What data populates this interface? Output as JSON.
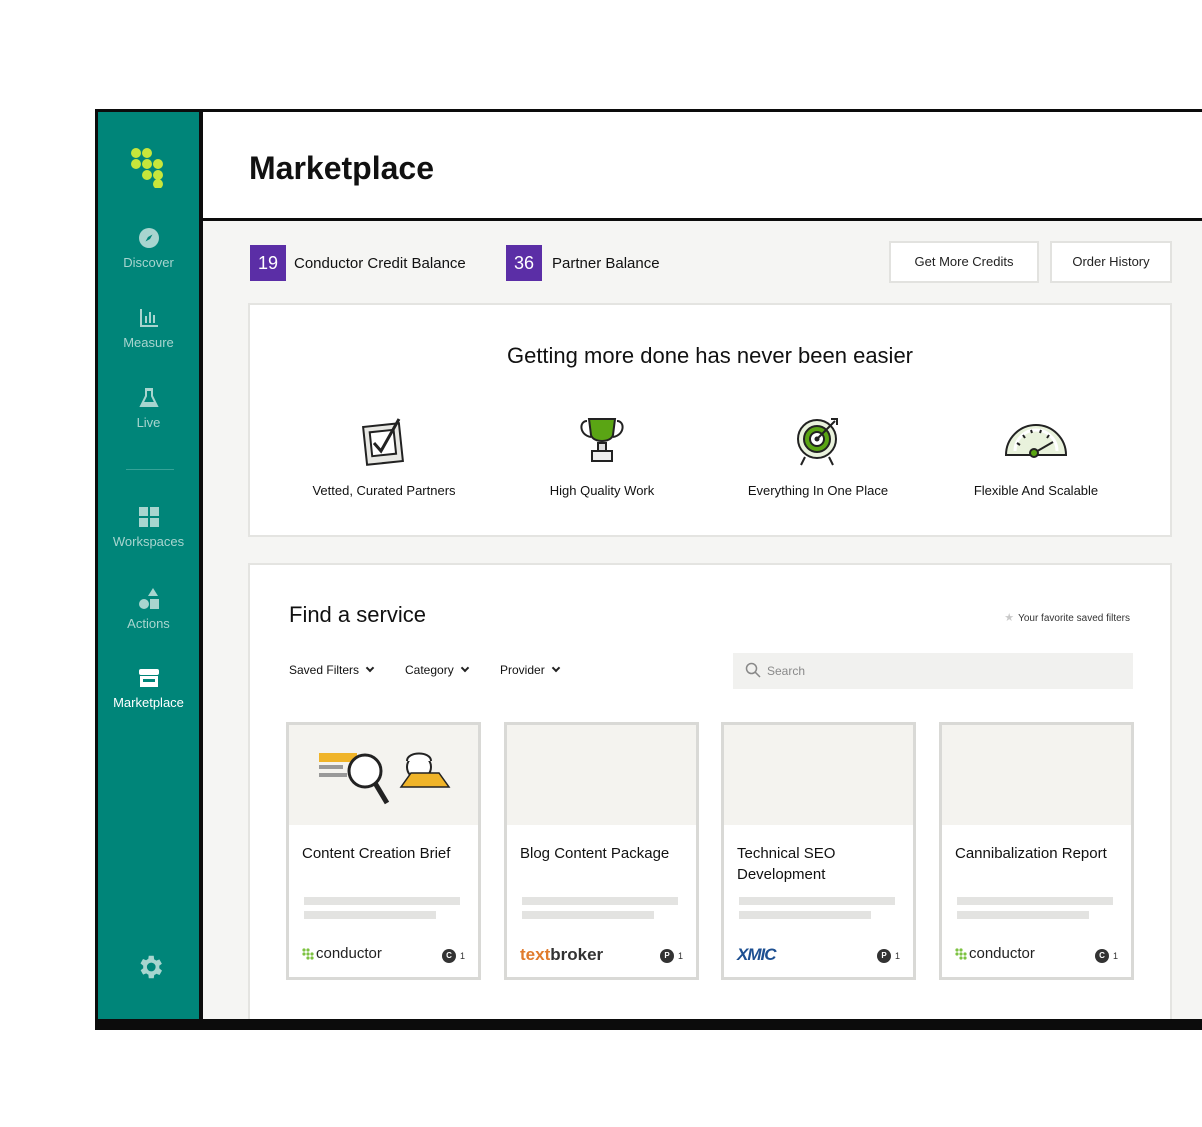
{
  "sidebar": {
    "items": [
      {
        "label": "Discover",
        "icon": "compass-icon"
      },
      {
        "label": "Measure",
        "icon": "bar-chart-icon"
      },
      {
        "label": "Live",
        "icon": "flask-icon"
      },
      {
        "label": "Workspaces",
        "icon": "grid-icon"
      },
      {
        "label": "Actions",
        "icon": "shapes-icon"
      },
      {
        "label": "Marketplace",
        "icon": "storefront-icon",
        "active": true
      }
    ],
    "settings_icon": "gear-icon",
    "accent": "#008579"
  },
  "header": {
    "title": "Marketplace"
  },
  "balances": {
    "credit_value": "19",
    "credit_label": "Conductor Credit Balance",
    "partner_value": "36",
    "partner_label": "Partner Balance",
    "badge_color": "#5b2ea6"
  },
  "actions": {
    "get_credits": "Get More Credits",
    "order_history": "Order History"
  },
  "promo": {
    "title": "Getting more done has never been easier",
    "features": [
      {
        "label": "Vetted, Curated Partners",
        "icon": "checkbox-icon"
      },
      {
        "label": "High Quality Work",
        "icon": "trophy-icon"
      },
      {
        "label": "Everything In One Place",
        "icon": "target-icon"
      },
      {
        "label": "Flexible And Scalable",
        "icon": "gauge-icon"
      }
    ]
  },
  "find_service": {
    "title": "Find a service",
    "favorites": "Your favorite saved filters",
    "filters": [
      "Saved Filters",
      "Category",
      "Provider"
    ],
    "search_placeholder": "Search",
    "cards": [
      {
        "title": "Content Creation Brief",
        "provider": "conductor",
        "credit_type": "C",
        "credits": "1"
      },
      {
        "title": "Blog Content Package",
        "provider": "textbroker",
        "provider_a": "text",
        "provider_b": "broker",
        "credit_type": "P",
        "credits": "1"
      },
      {
        "title": "Technical SEO Development",
        "provider": "XMIC",
        "credit_type": "P",
        "credits": "1"
      },
      {
        "title": "Cannibalization Report",
        "provider": "conductor",
        "credit_type": "C",
        "credits": "1"
      }
    ]
  }
}
